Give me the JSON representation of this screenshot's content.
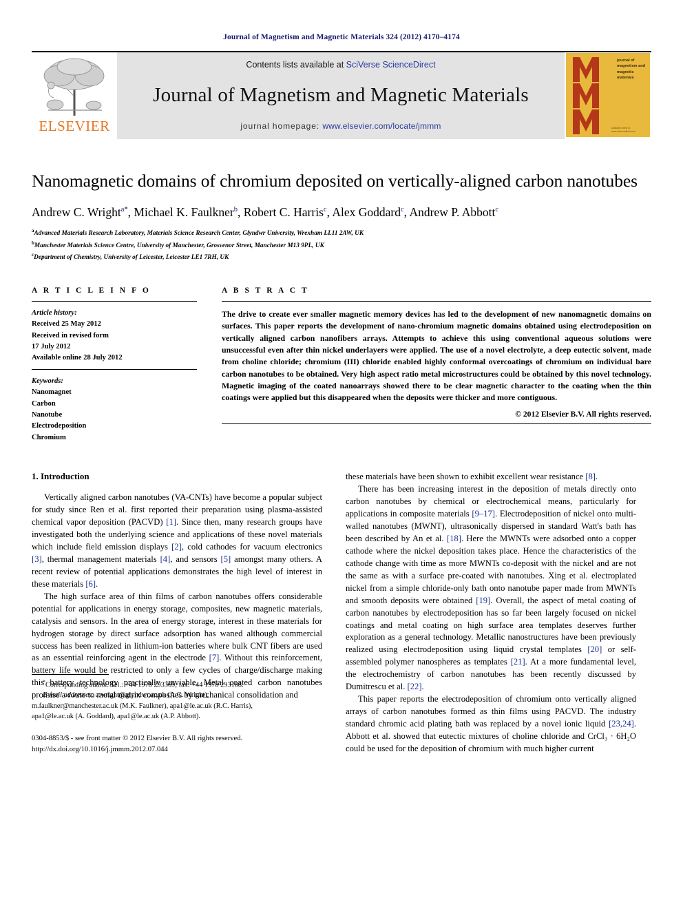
{
  "running_head": "Journal of Magnetism and Magnetic Materials 324 (2012) 4170–4174",
  "masthead": {
    "publisher_name": "ELSEVIER",
    "contents_prefix": "Contents lists available at ",
    "contents_link": "SciVerse ScienceDirect",
    "journal_name": "Journal of Magnetism and Magnetic Materials",
    "homepage_prefix": "journal homepage: ",
    "homepage_link": "www.elsevier.com/locate/jmmm",
    "cover_title": "journal of magnetism and magnetic materials",
    "cover_footer": "available online at www.sciencedirect.com",
    "cover_bg": "#e8b93c",
    "cover_letter_color": "#b5371a",
    "elsevier_orange": "#e87722",
    "link_color": "#2a3a9c"
  },
  "article": {
    "title": "Nanomagnetic domains of chromium deposited on vertically-aligned carbon nanotubes",
    "authors": [
      {
        "name": "Andrew C. Wright",
        "sup": "a",
        "star": "*",
        "sep": ", "
      },
      {
        "name": "Michael K. Faulkner",
        "sup": "b",
        "star": "",
        "sep": ", "
      },
      {
        "name": "Robert C. Harris",
        "sup": "c",
        "star": "",
        "sep": ", "
      },
      {
        "name": "Alex Goddard",
        "sup": "c",
        "star": "",
        "sep": ", "
      },
      {
        "name": "Andrew P. Abbott",
        "sup": "c",
        "star": "",
        "sep": ""
      }
    ],
    "affiliations": [
      {
        "marker": "a",
        "text": "Advanced Materials Research Laboratory, Materials Science Research Center, Glyndwr University, Wrexham LL11 2AW, UK"
      },
      {
        "marker": "b",
        "text": "Manchester Materials Science Centre, University of Manchester, Grosvenor Street, Manchester M13 9PL, UK"
      },
      {
        "marker": "c",
        "text": "Department of Chemistry, University of Leicester, Leicester LE1 7RH, UK"
      }
    ]
  },
  "article_info": {
    "label": "A R T I C L E   I N F O",
    "history_label": "Article history:",
    "history_lines": [
      "Received 25 May 2012",
      "Received in revised form",
      "17 July 2012",
      "Available online 28 July 2012"
    ],
    "keywords_label": "Keywords:",
    "keywords": [
      "Nanomagnet",
      "Carbon",
      "Nanotube",
      "Electrodeposition",
      "Chromium"
    ]
  },
  "abstract": {
    "label": "A B S T R A C T",
    "text": "The drive to create ever smaller magnetic memory devices has led to the development of new nanomagnetic domains on surfaces. This paper reports the development of nano-chromium magnetic domains obtained using electrodeposition on vertically aligned carbon nanofibers arrays. Attempts to achieve this using conventional aqueous solutions were unsuccessful even after thin nickel underlayers were applied. The use of a novel electrolyte, a deep eutectic solvent, made from choline chloride; chromium (III) chloride enabled highly conformal overcoatings of chromium on individual bare carbon nanotubes to be obtained. Very high aspect ratio metal microstructures could be obtained by this novel technology. Magnetic imaging of the coated nanoarrays showed there to be clear magnetic character to the coating when the thin coatings were applied but this disappeared when the deposits were thicker and more contiguous.",
    "copyright": "© 2012 Elsevier B.V. All rights reserved."
  },
  "body": {
    "section_number_title": "1.  Introduction",
    "left_paragraphs": [
      "Vertically aligned carbon nanotubes (VA-CNTs) have become a popular subject for study since Ren et al. first reported their preparation using plasma-assisted chemical vapor deposition (PACVD) [1]. Since then, many research groups have investigated both the underlying science and applications of these novel materials which include field emission displays [2], cold cathodes for vacuum electronics [3], thermal management materials [4], and sensors [5] amongst many others. A recent review of potential applications demonstrates the high level of interest in these materials [6].",
      "The high surface area of thin films of carbon nanotubes offers considerable potential for applications in energy storage, composites, new magnetic materials, catalysis and sensors. In the area of energy storage, interest in these materials for hydrogen storage by direct surface adsorption has waned although commercial success has been realized in lithium-ion batteries where bulk CNT fibers are used as an essential reinforcing agent in the electrode [7]. Without this reinforcement, battery life would be restricted to only a few cycles of charge/discharge making this battery technology practically unviable. Metal coated carbon nanotubes promise a route to metal matrix composites by mechanical consolidation and"
    ],
    "right_paragraphs": [
      "these materials have been shown to exhibit excellent wear resistance [8].",
      "There has been increasing interest in the deposition of metals directly onto carbon nanotubes by chemical or electrochemical means, particularly for applications in composite materials [9–17]. Electrodeposition of nickel onto multi-walled nanotubes (MWNT), ultrasonically dispersed in standard Watt's bath has been described by An et al. [18]. Here the MWNTs were adsorbed onto a copper cathode where the nickel deposition takes place. Hence the characteristics of the cathode change with time as more MWNTs co-deposit with the nickel and are not the same as with a surface pre-coated with nanotubes. Xing et al. electroplated nickel from a simple chloride-only bath onto nanotube paper made from MWNTs and smooth deposits were obtained [19]. Overall, the aspect of metal coating of carbon nanotubes by electrodeposition has so far been largely focused on nickel coatings and metal coating on high surface area templates deserves further exploration as a general technology. Metallic nanostructures have been previously realized using electrodeposition using liquid crystal templates [20] or self-assembled polymer nanospheres as templates [21]. At a more fundamental level, the electrochemistry of carbon nanotubes has been recently discussed by Dumitrescu et al. [22].",
      "This paper reports the electrodeposition of chromium onto vertically aligned arrays of carbon nanotubes formed as thin films using PACVD. The industry standard chromic acid plating bath was replaced by a novel ionic liquid [23,24]. Abbott et al. showed that eutectic mixtures of choline chloride and CrCl₃ · 6H₂O could be used for the deposition of chromium with much higher current"
    ]
  },
  "footnotes": {
    "corresponding": "Corresponding author. Tel.: +44 1978 293369; fax: +44 1978 293168.",
    "corresponding_marker": "*",
    "email_label": "E-mail addresses:",
    "email_lines": [
      "a.wright@glyndwr.ac.uk (A.C. Wright),",
      "m.faulkner@manchester.ac.uk (M.K. Faulkner), apa1@le.ac.uk (R.C. Harris),",
      "apa1@le.ac.uk (A. Goddard), apa1@le.ac.uk (A.P. Abbott)."
    ],
    "frontmatter": "0304-8853/$ - see front matter © 2012 Elsevier B.V. All rights reserved.",
    "doi": "http://dx.doi.org/10.1016/j.jmmm.2012.07.044"
  }
}
